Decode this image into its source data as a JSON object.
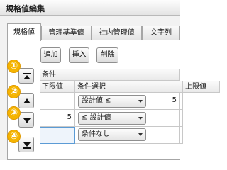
{
  "window": {
    "title": "規格値編集"
  },
  "tabs": [
    {
      "label": "規格値"
    },
    {
      "label": "管理基準値"
    },
    {
      "label": "社内管理値"
    },
    {
      "label": "文字列"
    }
  ],
  "toolbar": {
    "add_label": "追加",
    "insert_label": "挿入",
    "delete_label": "削除"
  },
  "grid": {
    "group_header": "条件",
    "columns": [
      "下限値",
      "条件選択",
      "上限値"
    ],
    "rows": [
      {
        "lower": "",
        "condition": "設計値 ≦",
        "upper": "5"
      },
      {
        "lower": "5",
        "condition": "≦ 設計値",
        "upper": ""
      },
      {
        "lower": "",
        "condition": "条件なし",
        "upper": ""
      }
    ]
  },
  "move_buttons": [
    {
      "icon": "move-to-top-icon",
      "badge": "①"
    },
    {
      "icon": "move-up-icon",
      "badge": "②"
    },
    {
      "icon": "move-down-icon",
      "badge": "③"
    },
    {
      "icon": "move-to-bottom-icon",
      "badge": "④"
    }
  ],
  "colors": {
    "badge": "#f5b400",
    "selected_cell_border": "#5b9bd5",
    "tab_border": "#a6a6a6"
  }
}
